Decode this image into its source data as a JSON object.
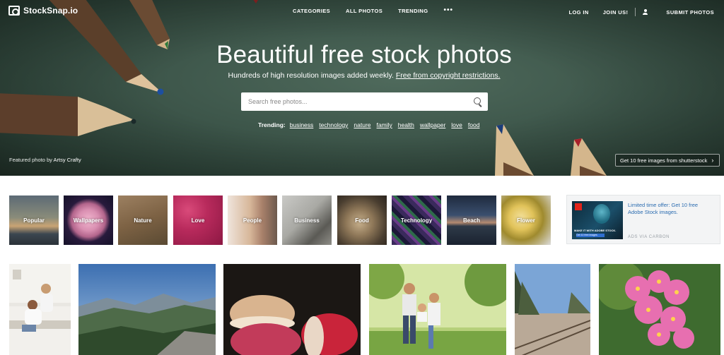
{
  "brand": {
    "name": "StockSnap.io"
  },
  "nav": {
    "categories": "CATEGORIES",
    "all_photos": "ALL PHOTOS",
    "trending": "TRENDING",
    "more": "•••",
    "login": "LOG IN",
    "join": "JOIN US!",
    "submit": "SUBMIT PHOTOS"
  },
  "hero": {
    "title": "Beautiful free stock photos",
    "subtitle_a": "Hundreds of high resolution images added weekly. ",
    "subtitle_b": "Free from copyright restrictions.",
    "search_placeholder": "Search free photos...",
    "trending_label": "Trending:",
    "trending_tags": [
      "business",
      "technology",
      "nature",
      "family",
      "health",
      "wallpaper",
      "love",
      "food"
    ],
    "featured_prefix": "Featured photo by ",
    "featured_author": "Artsy Crafty",
    "shutterstock_cta": "Get 10 free images from shutterstock",
    "shutterstock_chevron": "›"
  },
  "categories": [
    {
      "label": "Popular"
    },
    {
      "label": "Wallpapers"
    },
    {
      "label": "Nature"
    },
    {
      "label": "Love"
    },
    {
      "label": "People"
    },
    {
      "label": "Business"
    },
    {
      "label": "Food"
    },
    {
      "label": "Technology"
    },
    {
      "label": "Beach"
    },
    {
      "label": "Flower"
    }
  ],
  "ad": {
    "text": "Limited time offer: Get 10 free Adobe Stock images.",
    "via": "ADS VIA CARBON",
    "img_caption": "MAKE IT WITH ADOBE STOCK.",
    "img_button": "Get 10 free images"
  },
  "colors": {
    "hero_bg": "#3f584c",
    "ad_link": "#2b6cb0",
    "page_bg": "#ffffff"
  }
}
